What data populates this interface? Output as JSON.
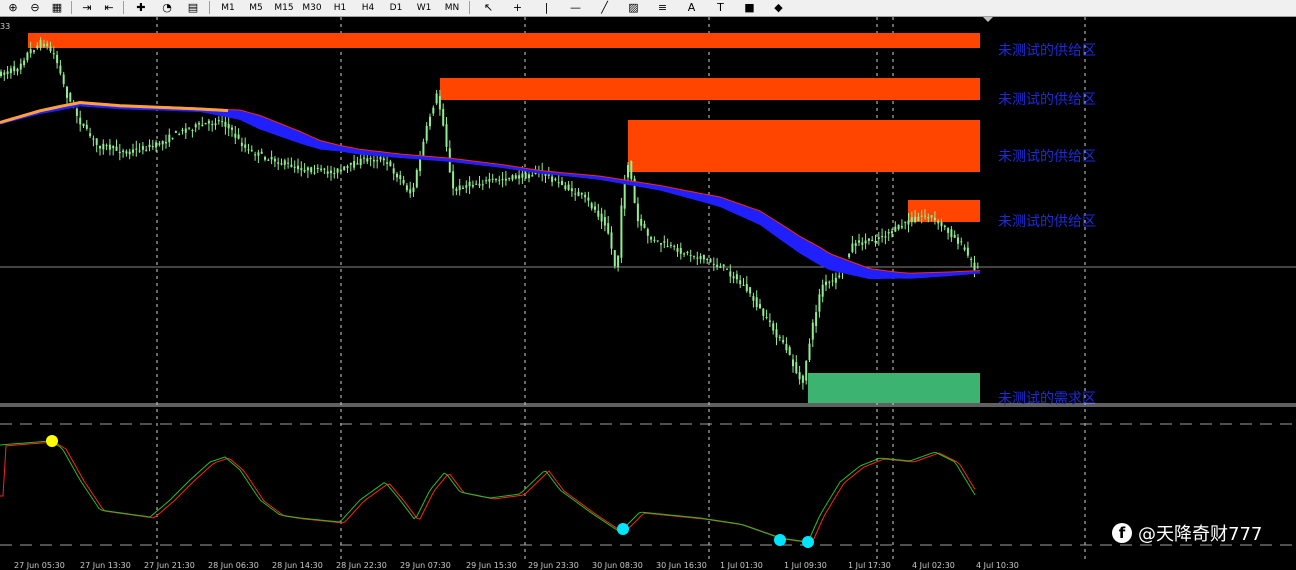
{
  "toolbar": {
    "items": [
      {
        "name": "zoom-in-icon",
        "glyph": "⊕"
      },
      {
        "name": "zoom-out-icon",
        "glyph": "⊖"
      },
      {
        "name": "tile-windows-icon",
        "glyph": "▦"
      },
      {
        "name": "auto-scroll-icon",
        "glyph": "⇥"
      },
      {
        "name": "chart-shift-icon",
        "glyph": "⇤"
      },
      {
        "name": "indicators-icon",
        "glyph": "✚"
      },
      {
        "name": "periods-icon",
        "glyph": "◔"
      },
      {
        "name": "templates-icon",
        "glyph": "▤"
      }
    ],
    "timeframes": [
      "M1",
      "M5",
      "M15",
      "M30",
      "H1",
      "H4",
      "D1",
      "W1",
      "MN"
    ],
    "tools": [
      {
        "name": "cursor-icon",
        "glyph": "↖"
      },
      {
        "name": "crosshair-icon",
        "glyph": "+"
      },
      {
        "name": "vertical-line-icon",
        "glyph": "|"
      },
      {
        "name": "horizontal-line-icon",
        "glyph": "—"
      },
      {
        "name": "trendline-icon",
        "glyph": "╱"
      },
      {
        "name": "channel-icon",
        "glyph": "▨"
      },
      {
        "name": "fibonacci-icon",
        "glyph": "≡"
      },
      {
        "name": "text-tool-icon",
        "glyph": "A"
      },
      {
        "name": "text-label-icon",
        "glyph": "T"
      },
      {
        "name": "arrow-icon",
        "glyph": "■"
      },
      {
        "name": "shapes-icon",
        "glyph": "◆"
      }
    ]
  },
  "price_tag": "33",
  "zones": [
    {
      "label": "未测试的供给区",
      "type": "supply",
      "color": "#ff4500"
    },
    {
      "label": "未测试的供给区",
      "type": "supply",
      "color": "#ff4500"
    },
    {
      "label": "未测试的供给区",
      "type": "supply",
      "color": "#ff4500"
    },
    {
      "label": "未测试的供给区",
      "type": "supply",
      "color": "#ff4500"
    },
    {
      "label": "未测试的需求区",
      "type": "demand",
      "color": "#3cb371"
    }
  ],
  "x_labels": [
    "27 Jun 05:30",
    "27 Jun 13:30",
    "27 Jun 21:30",
    "28 Jun 06:30",
    "28 Jun 14:30",
    "28 Jun 22:30",
    "29 Jun 07:30",
    "29 Jun 15:30",
    "29 Jun 23:30",
    "30 Jun 08:30",
    "30 Jun 16:30",
    "1 Jul 01:30",
    "1 Jul 09:30",
    "1 Jul 17:30",
    "4 Jul 02:30",
    "4 Jul 10:30"
  ],
  "watermark": "@天降奇财777",
  "colors": {
    "candle": "#90ee90",
    "ma_upper": "#ff2020",
    "ma_lower": "#2020ff",
    "stoch_main": "#20c020",
    "stoch_signal": "#ff2020",
    "dot_yellow": "#ffff00",
    "dot_cyan": "#00e5ff"
  }
}
